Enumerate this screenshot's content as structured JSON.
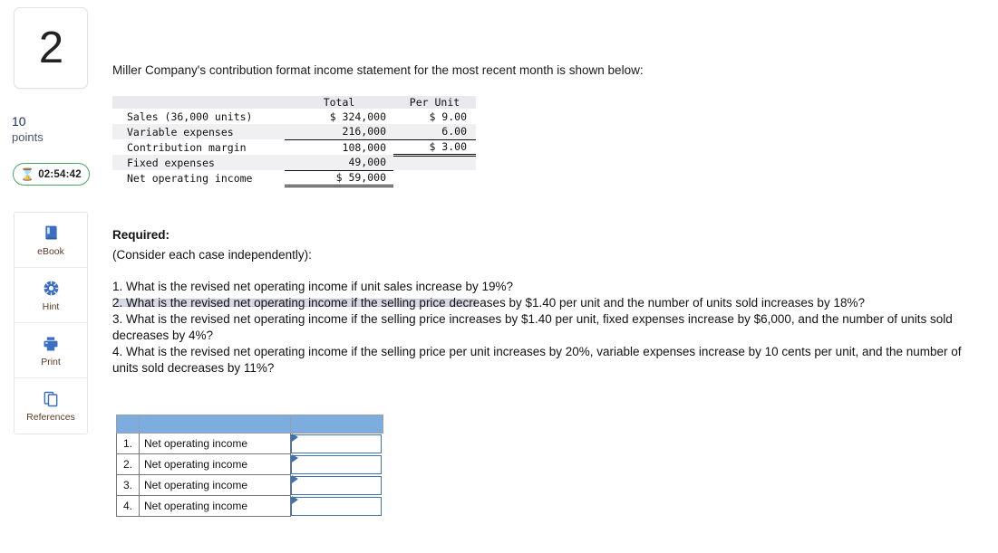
{
  "question": {
    "number": "2",
    "points_value": "10",
    "points_label": "points",
    "timer": "02:54:42",
    "timer_icon": "hourglass-icon"
  },
  "tools": [
    {
      "label": "eBook",
      "icon": "ebook-icon"
    },
    {
      "label": "Hint",
      "icon": "hint-icon"
    },
    {
      "label": "Print",
      "icon": "printer-icon"
    },
    {
      "label": "References",
      "icon": "references-icon"
    }
  ],
  "intro": "Miller Company's contribution format income statement for the most recent month is shown below:",
  "income_statement": {
    "headers": {
      "blank": "",
      "total": "Total",
      "per_unit": "Per Unit"
    },
    "rows": [
      {
        "label": "Sales (36,000 units)",
        "total": "$ 324,000",
        "per_unit": "$ 9.00"
      },
      {
        "label": "Variable expenses",
        "total": "216,000",
        "per_unit": "6.00"
      },
      {
        "label": "Contribution margin",
        "total": "108,000",
        "per_unit": "$ 3.00"
      },
      {
        "label": "Fixed expenses",
        "total": "49,000",
        "per_unit": ""
      },
      {
        "label": "Net operating income",
        "total": "$   59,000",
        "per_unit": ""
      }
    ]
  },
  "required": {
    "title": "Required:",
    "subtitle": "(Consider each case independently):",
    "questions": [
      "1. What is the revised net operating income if unit sales increase by 19%?",
      "2. What is the revised net operating income if the selling price decreases by $1.40 per unit and the number of units sold increases by 18%?",
      "3. What is the revised net operating income if the selling price increases by $1.40 per unit, fixed expenses increase by $6,000, and the number of units sold decreases by 4%?",
      "4. What is the revised net operating income if the selling price per unit increases by 20%, variable expenses increase by 10 cents per unit, and the number of units sold decreases by 11%?"
    ]
  },
  "answer_table": {
    "header": {
      "col1": "",
      "col2": "",
      "col3": ""
    },
    "rows": [
      {
        "num": "1.",
        "label": "Net operating income",
        "value": ""
      },
      {
        "num": "2.",
        "label": "Net operating income",
        "value": ""
      },
      {
        "num": "3.",
        "label": "Net operating income",
        "value": ""
      },
      {
        "num": "4.",
        "label": "Net operating income",
        "value": ""
      }
    ]
  },
  "colors": {
    "answer_header_blue": "#7cadde",
    "input_border_blue": "#3f72af",
    "timer_green": "#4aa564",
    "points_navy": "#1b2a5e",
    "tool_label_brown": "#5a3a23"
  }
}
